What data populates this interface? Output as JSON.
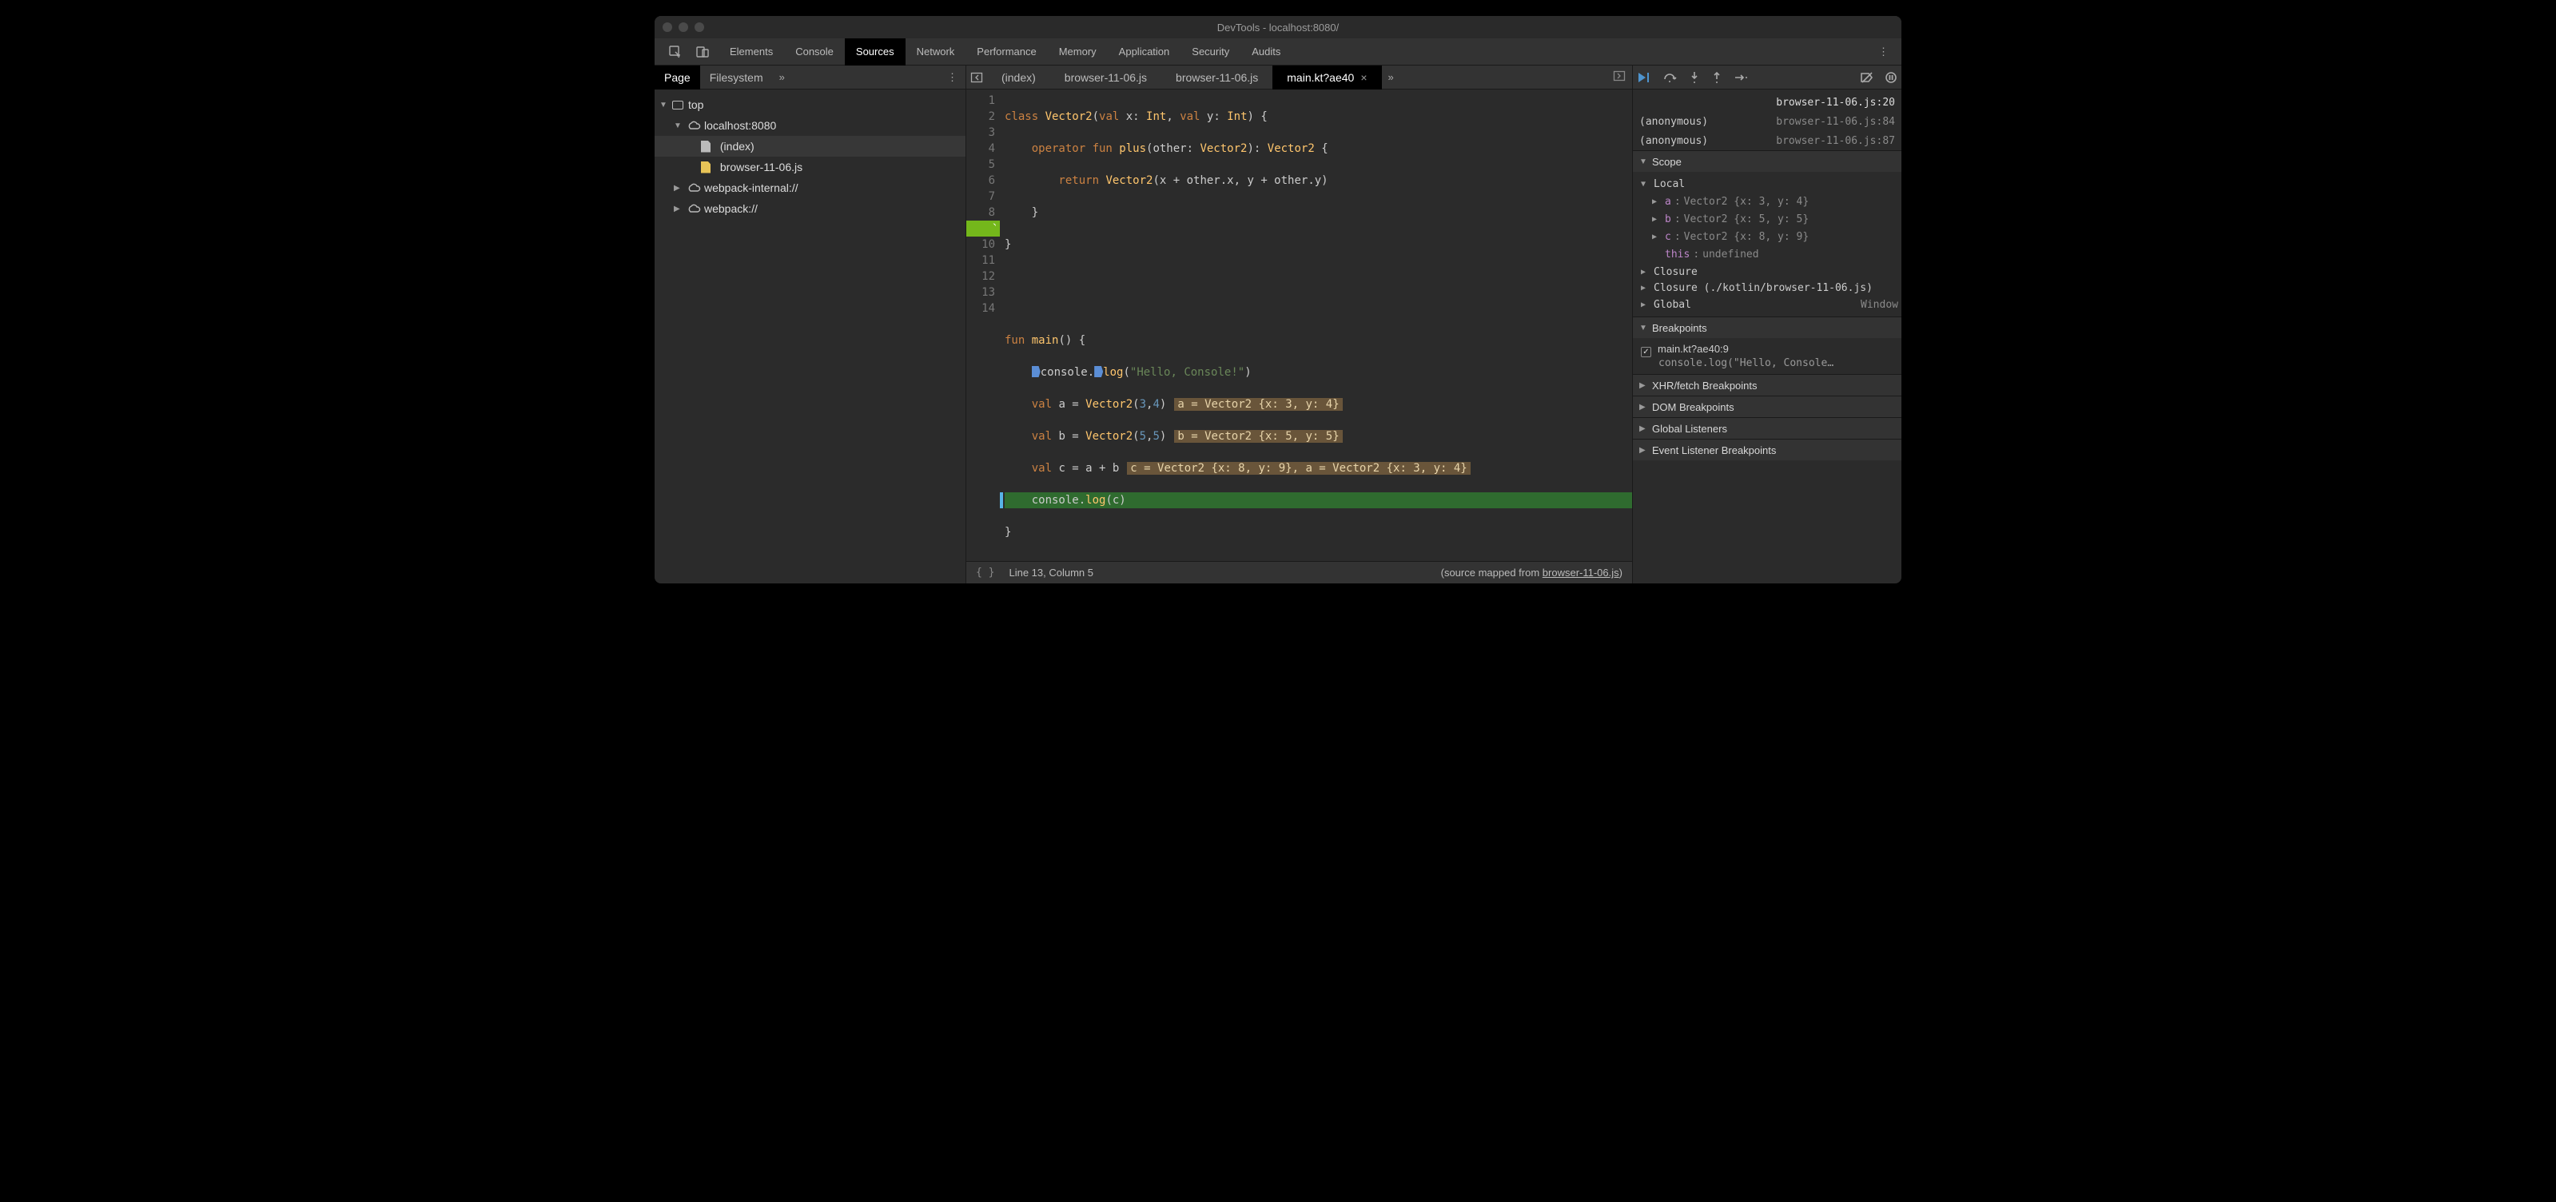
{
  "window": {
    "title": "DevTools - localhost:8080/"
  },
  "main_tabs": [
    "Elements",
    "Console",
    "Sources",
    "Network",
    "Performance",
    "Memory",
    "Application",
    "Security",
    "Audits"
  ],
  "main_active": 2,
  "sidebar": {
    "tabs": [
      "Page",
      "Filesystem"
    ],
    "active": 0,
    "tree": {
      "top": "top",
      "host": "localhost:8080",
      "index": "(index)",
      "file": "browser-11-06.js",
      "wpi": "webpack-internal://",
      "wp": "webpack://"
    }
  },
  "editor": {
    "tabs": [
      "(index)",
      "browser-11-06.js",
      "browser-11-06.js",
      "main.kt?ae40"
    ],
    "active": 3,
    "status_cursor": "Line 13, Column 5",
    "status_map_prefix": "(source mapped from ",
    "status_map_link": "browser-11-06.js",
    "status_map_suffix": ")",
    "source": {
      "l1_a": "class ",
      "l1_b": "Vector2",
      "l1_c": "(",
      "l1_d": "val ",
      "l1_e": "x: ",
      "l1_f": "Int",
      "l1_g": ", ",
      "l1_h": "val ",
      "l1_i": "y: ",
      "l1_j": "Int",
      "l1_k": ") {",
      "l2_a": "    operator fun ",
      "l2_b": "plus",
      "l2_c": "(other: ",
      "l2_d": "Vector2",
      "l2_e": "): ",
      "l2_f": "Vector2",
      "l2_g": " {",
      "l3_a": "        return ",
      "l3_b": "Vector2",
      "l3_c": "(x + other.x, y + other.y)",
      "l4": "    }",
      "l5": "}",
      "l8_a": "fun ",
      "l8_b": "main",
      "l8_c": "() {",
      "l9_a": "    ",
      "l9_b": "console.",
      "l9_c": "log",
      "l9_d": "(",
      "l9_e": "\"Hello, Console!\"",
      "l9_f": ")",
      "l10_a": "    val ",
      "l10_b": "a = ",
      "l10_c": "Vector2",
      "l10_d": "(",
      "l10_e": "3",
      "l10_f": ",",
      "l10_g": "4",
      "l10_h": ")",
      "l10_dbg": "a = Vector2 {x: 3, y: 4}",
      "l11_a": "    val ",
      "l11_b": "b = ",
      "l11_c": "Vector2",
      "l11_d": "(",
      "l11_e": "5",
      "l11_f": ",",
      "l11_g": "5",
      "l11_h": ")",
      "l11_dbg": "b = Vector2 {x: 5, y: 5}",
      "l12_a": "    val ",
      "l12_b": "c = a + b",
      "l12_dbg": "c = Vector2 {x: 8, y: 9}, a = Vector2 {x: 3, y: 4}",
      "l13_a": "    ",
      "l13_b": "console.",
      "l13_c": "log",
      "l13_d": "(c)",
      "l14": "}"
    }
  },
  "debugger": {
    "callstack": [
      {
        "name": "",
        "loc": "browser-11-06.js:20",
        "top": true
      },
      {
        "name": "(anonymous)",
        "loc": "browser-11-06.js:84"
      },
      {
        "name": "(anonymous)",
        "loc": "browser-11-06.js:87"
      }
    ],
    "scope_title": "Scope",
    "local_title": "Local",
    "local": [
      {
        "name": "a",
        "val": "Vector2 {x: 3, y: 4}"
      },
      {
        "name": "b",
        "val": "Vector2 {x: 5, y: 5}"
      },
      {
        "name": "c",
        "val": "Vector2 {x: 8, y: 9}"
      }
    ],
    "this_label": "this",
    "this_val": "undefined",
    "closure": "Closure",
    "closure2": "Closure (./kotlin/browser-11-06.js)",
    "global": "Global",
    "global_val": "Window",
    "bp_title": "Breakpoints",
    "bp_loc": "main.kt?ae40:9",
    "bp_code": "console.log(\"Hello, Console…",
    "sec_xhr": "XHR/fetch Breakpoints",
    "sec_dom": "DOM Breakpoints",
    "sec_gl": "Global Listeners",
    "sec_ev": "Event Listener Breakpoints"
  }
}
